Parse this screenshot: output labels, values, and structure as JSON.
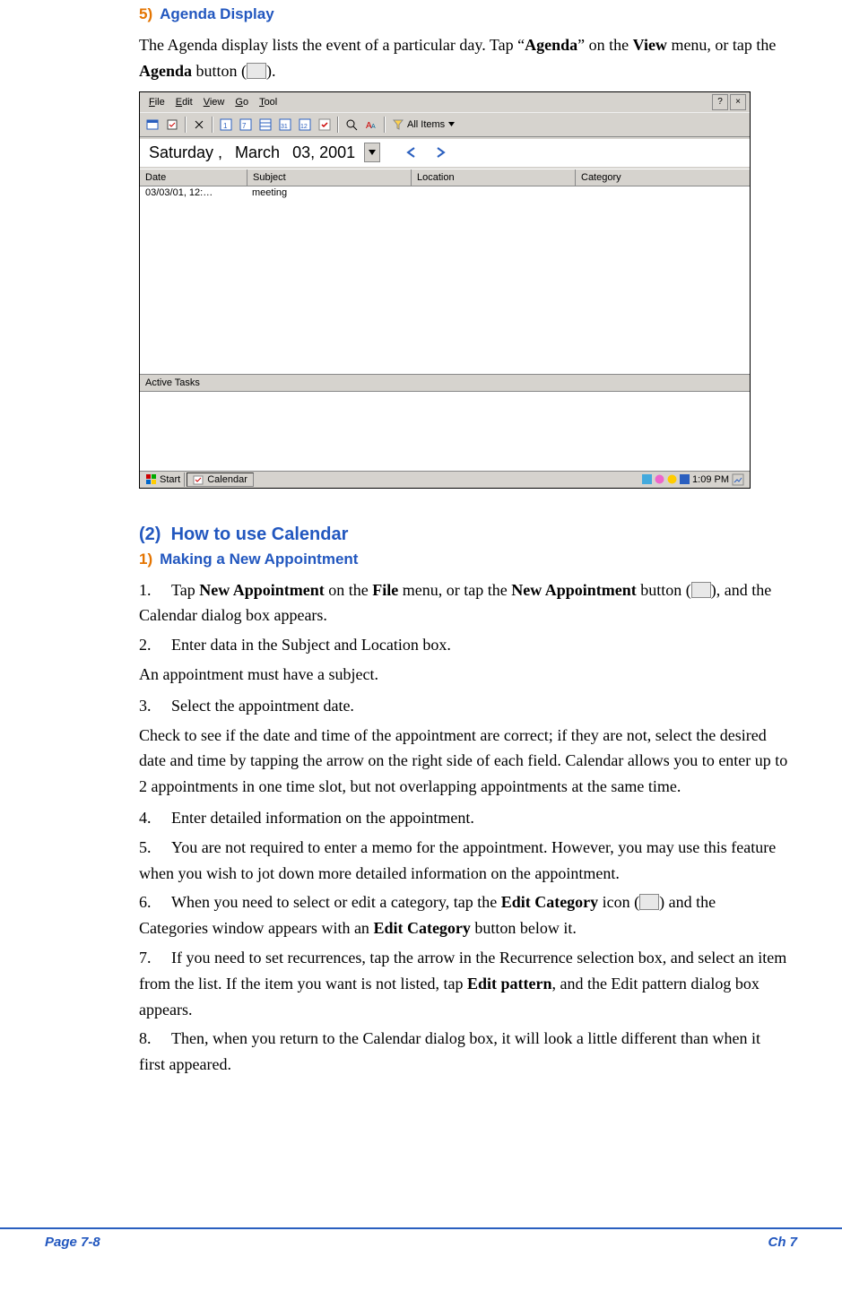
{
  "section5": {
    "num": "5)",
    "title": "Agenda Display"
  },
  "intro": {
    "part1": "The Agenda display lists the event of a particular day. Tap “",
    "bold1": "Agenda",
    "part2": "” on the ",
    "bold2": "View",
    "part3": " menu, or tap the ",
    "bold3": "Agenda",
    "part4": " button (",
    "part5": ")."
  },
  "window": {
    "menus": [
      "File",
      "Edit",
      "View",
      "Go",
      "Tool"
    ],
    "help": "?",
    "close": "×",
    "allitems": "All Items",
    "date": {
      "weekday": "Saturday ,",
      "month": "March",
      "day": "03, 2001"
    },
    "columns": {
      "date": "Date",
      "subject": "Subject",
      "location": "Location",
      "category": "Category"
    },
    "row": {
      "date": "03/03/01, 12:…",
      "subject": "meeting"
    },
    "activeTasks": "Active Tasks",
    "start": "Start",
    "app": "Calendar",
    "clock": "1:09 PM"
  },
  "section2": {
    "num": "(2)",
    "title": "How to use Calendar"
  },
  "sub1": {
    "num": "1)",
    "title": "Making a New Appointment"
  },
  "steps": {
    "s1a": "Tap ",
    "s1b": "New Appointment",
    "s1c": " on the ",
    "s1d": "File",
    "s1e": " menu, or tap the ",
    "s1f": "New Appointment",
    "s1g": " button (",
    "s1h": "), and the Calendar dialog box appears.",
    "s2": "Enter data in the Subject and Location box.",
    "s2note": "An appointment must have a subject.",
    "s3": "Select the appointment date.",
    "s3note": "Check to see if the date and time of the appointment are correct; if they are not, select the desired date and time by tapping the arrow on the right side of each field. Calendar allows you to enter up to 2 appointments in one time slot, but not overlapping appointments at the same time.",
    "s4": "Enter detailed information on the appointment.",
    "s5": "You are not required to enter a memo for the appointment. However, you may use this feature when you wish to jot down more detailed information on the appointment.",
    "s6a": "When you need to select or edit a category, tap the ",
    "s6b": "Edit Category",
    "s6c": " icon (",
    "s6d": ") and the Categories window appears with an ",
    "s6e": "Edit Category",
    "s6f": " button below it.",
    "s7a": "If you need to set recurrences, tap the arrow in the Recurrence selection box, and select an item from the list. If the item you want is not listed, tap ",
    "s7b": "Edit pattern",
    "s7c": ", and the Edit pattern dialog box appears.",
    "s8": "Then, when you return to the Calendar dialog box, it will look a little different than when it first appeared."
  },
  "nums": {
    "n1": "1.",
    "n2": "2.",
    "n3": "3.",
    "n4": "4.",
    "n5": "5.",
    "n6": "6.",
    "n7": "7.",
    "n8": "8."
  },
  "footer": {
    "left": "Page 7-8",
    "right": "Ch 7"
  }
}
